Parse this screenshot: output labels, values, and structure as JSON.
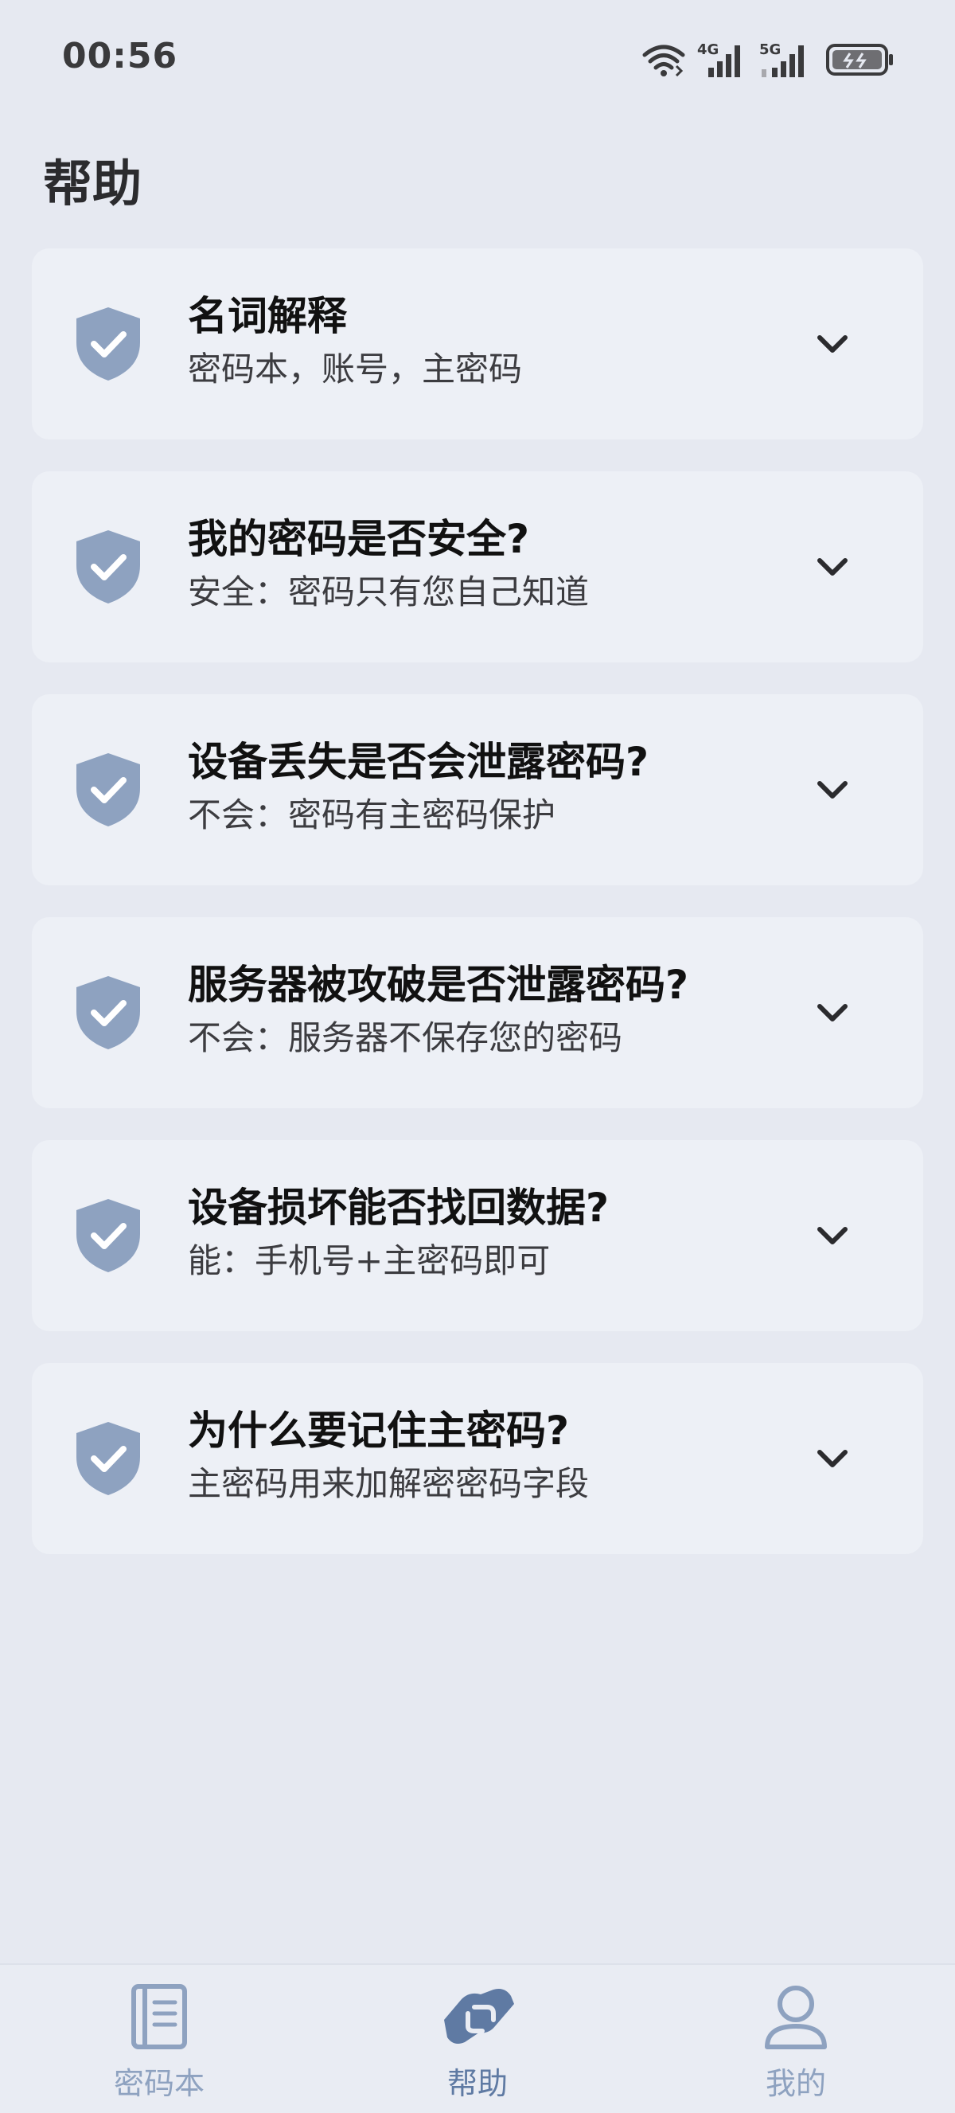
{
  "status_bar": {
    "time": "00:56",
    "network_a": "4G",
    "network_b": "5G"
  },
  "header": {
    "title": "帮助"
  },
  "faq": [
    {
      "question": "名词解释",
      "answer": "密码本，账号，主密码"
    },
    {
      "question": "我的密码是否安全?",
      "answer": "安全：密码只有您自己知道"
    },
    {
      "question": "设备丢失是否会泄露密码?",
      "answer": "不会：密码有主密码保护"
    },
    {
      "question": "服务器被攻破是否泄露密码?",
      "answer": "不会：服务器不保存您的密码"
    },
    {
      "question": "设备损坏能否找回数据?",
      "answer": "能：手机号+主密码即可"
    },
    {
      "question": "为什么要记住主密码?",
      "answer": "主密码用来加解密密码字段"
    }
  ],
  "bottom_nav": {
    "items": [
      {
        "label": "密码本",
        "icon": "book-icon",
        "active": false
      },
      {
        "label": "帮助",
        "icon": "handshake-icon",
        "active": true
      },
      {
        "label": "我的",
        "icon": "person-icon",
        "active": false
      }
    ]
  },
  "colors": {
    "background": "#e6e9f1",
    "card": "#edf0f6",
    "shield": "#8ea2c0",
    "nav_inactive": "#8ea2c0",
    "nav_active": "#5f7aa3"
  }
}
